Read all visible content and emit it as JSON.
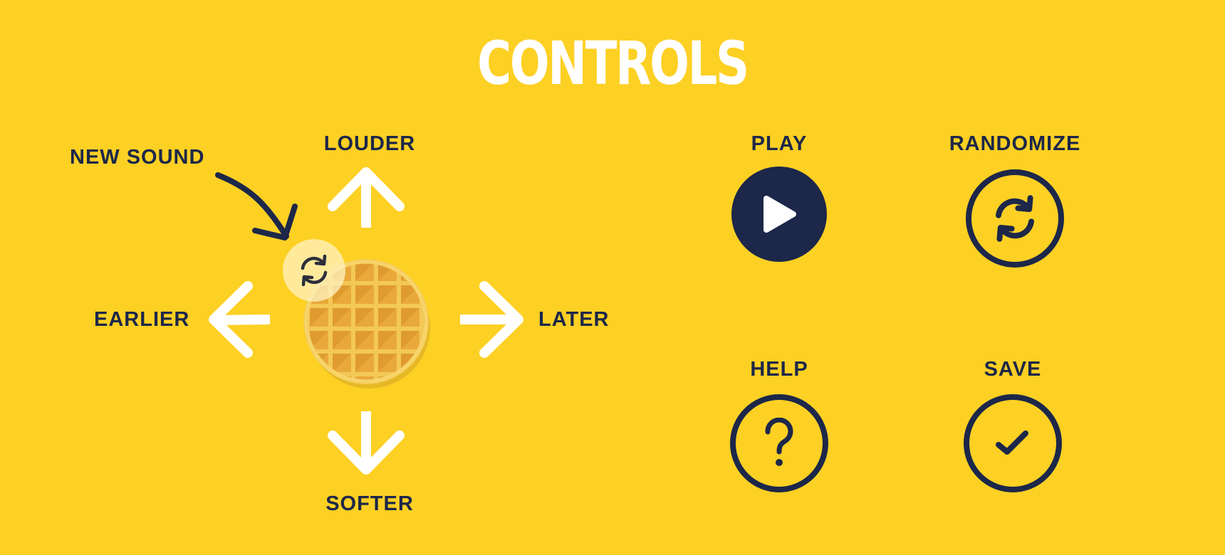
{
  "page": {
    "title": "CONTROLS",
    "background": "#FDD024",
    "ink": "#1C2749"
  },
  "left": {
    "new_sound_label": "NEW SOUND",
    "louder_label": "LOUDER",
    "softer_label": "SOFTER",
    "earlier_label": "EARLIER",
    "later_label": "LATER",
    "icons": {
      "up": "arrow-up-icon",
      "down": "arrow-down-icon",
      "left": "arrow-left-icon",
      "right": "arrow-right-icon",
      "pointer": "curved-arrow-icon",
      "refresh": "refresh-icon",
      "waffle": "waffle-icon"
    }
  },
  "right": {
    "play_label": "PLAY",
    "randomize_label": "RANDOMIZE",
    "help_label": "HELP",
    "save_label": "SAVE",
    "icons": {
      "play": "play-icon",
      "randomize": "refresh-icon",
      "help": "question-mark-icon",
      "save": "checkmark-icon"
    }
  }
}
